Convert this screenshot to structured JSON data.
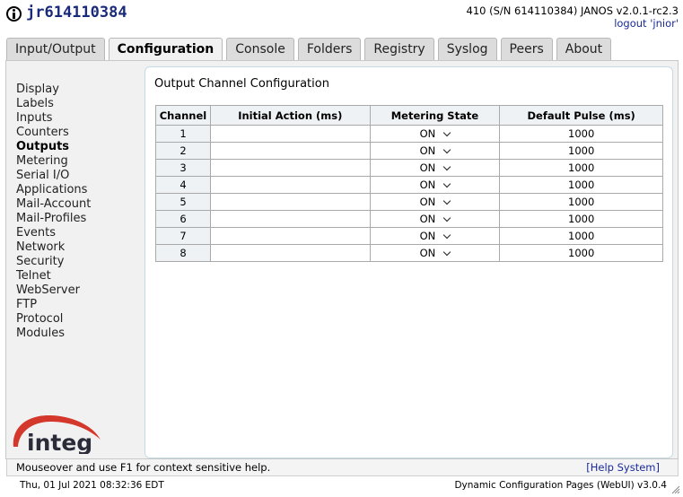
{
  "header": {
    "title": "jr614110384",
    "version": "410 (S/N 614110384) JANOS v2.0.1-rc2.3",
    "logout": "logout 'jnior'"
  },
  "tabs": [
    {
      "label": "Input/Output"
    },
    {
      "label": "Configuration"
    },
    {
      "label": "Console"
    },
    {
      "label": "Folders"
    },
    {
      "label": "Registry"
    },
    {
      "label": "Syslog"
    },
    {
      "label": "Peers"
    },
    {
      "label": "About"
    }
  ],
  "sidebar": {
    "items": [
      {
        "label": "Display"
      },
      {
        "label": "Labels"
      },
      {
        "label": "Inputs"
      },
      {
        "label": "Counters"
      },
      {
        "label": "Outputs"
      },
      {
        "label": "Metering"
      },
      {
        "label": "Serial I/O"
      },
      {
        "label": "Applications"
      },
      {
        "label": "Mail-Account"
      },
      {
        "label": "Mail-Profiles"
      },
      {
        "label": "Events"
      },
      {
        "label": "Network"
      },
      {
        "label": "Security"
      },
      {
        "label": "Telnet"
      },
      {
        "label": "WebServer"
      },
      {
        "label": "FTP"
      },
      {
        "label": "Protocol"
      },
      {
        "label": "Modules"
      }
    ],
    "logo_text": "integ"
  },
  "panel": {
    "title": "Output Channel Configuration",
    "columns": [
      "Channel",
      "Initial Action (ms)",
      "Metering State",
      "Default Pulse (ms)"
    ],
    "rows": [
      {
        "channel": "1",
        "initial_action": "",
        "metering": "ON",
        "pulse": "1000"
      },
      {
        "channel": "2",
        "initial_action": "",
        "metering": "ON",
        "pulse": "1000"
      },
      {
        "channel": "3",
        "initial_action": "",
        "metering": "ON",
        "pulse": "1000"
      },
      {
        "channel": "4",
        "initial_action": "",
        "metering": "ON",
        "pulse": "1000"
      },
      {
        "channel": "5",
        "initial_action": "",
        "metering": "ON",
        "pulse": "1000"
      },
      {
        "channel": "6",
        "initial_action": "",
        "metering": "ON",
        "pulse": "1000"
      },
      {
        "channel": "7",
        "initial_action": "",
        "metering": "ON",
        "pulse": "1000"
      },
      {
        "channel": "8",
        "initial_action": "",
        "metering": "ON",
        "pulse": "1000"
      }
    ]
  },
  "helpbar": {
    "text": "Mouseover and use F1 for context sensitive help.",
    "link": "[Help System]"
  },
  "status": {
    "datetime": "Thu, 01 Jul 2021 08:32:36 EDT",
    "app": "Dynamic Configuration Pages (WebUI) v3.0.4"
  },
  "colors": {
    "title": "#1a2a7a",
    "link": "#1a2a9a",
    "logo_red": "#d4372b",
    "logo_dark": "#2b2b3a"
  }
}
